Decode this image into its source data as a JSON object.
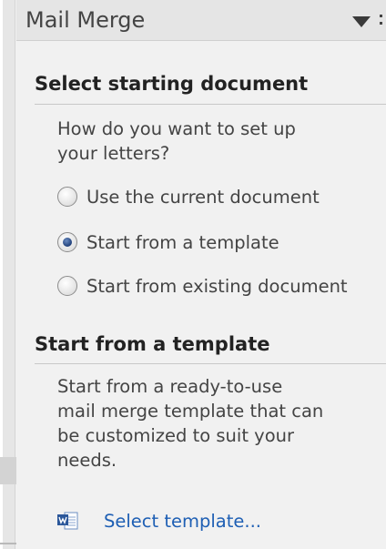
{
  "pane": {
    "title": "Mail Merge",
    "menu_icon": "dropdown-triangle-icon",
    "close_icon": "close-icon"
  },
  "section_start_doc": {
    "heading": "Select starting document",
    "question": "How do you want to set up\nyour letters?",
    "options": [
      {
        "label": "Use the current document",
        "checked": false
      },
      {
        "label": "Start from a template",
        "checked": true
      },
      {
        "label": "Start from existing document",
        "checked": false
      }
    ]
  },
  "section_template": {
    "heading": "Start from a template",
    "description": "Start from a ready-to-use\nmail merge template that can\nbe customized to suit your\nneeds.",
    "link_label": "Select template...",
    "link_icon": "word-document-icon"
  },
  "colors": {
    "link": "#1e5fb4",
    "selected_radio": "#1f3f7a"
  }
}
